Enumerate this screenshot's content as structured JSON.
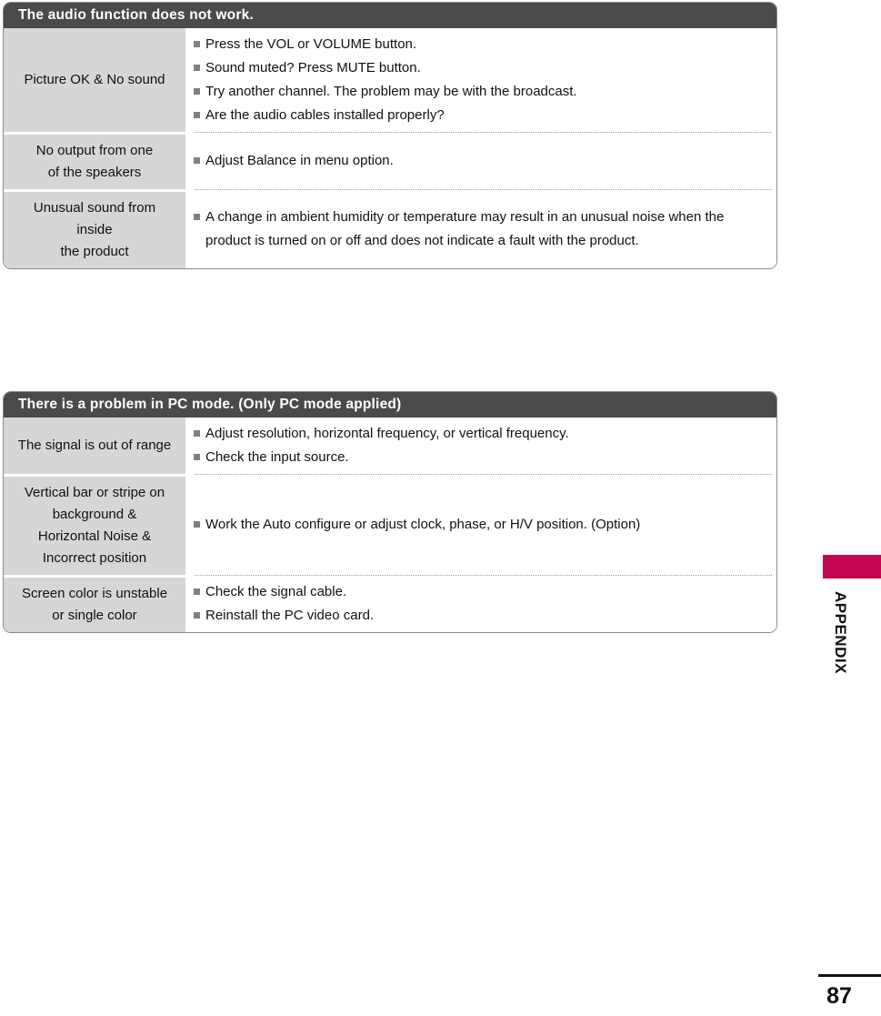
{
  "page": {
    "number": "87",
    "section_label": "APPENDIX",
    "tab_color": "#c4054e",
    "header_bar_color": "#4a4a4a",
    "symptom_cell_color": "#d6d6d6"
  },
  "tables": [
    {
      "title": "The audio function does not work.",
      "rows": [
        {
          "symptom_lines": [
            "Picture OK & No sound"
          ],
          "causes": [
            "Press the VOL or VOLUME button.",
            "Sound muted? Press MUTE button.",
            "Try another channel. The problem may be with the broadcast.",
            "Are the audio cables installed properly?"
          ]
        },
        {
          "symptom_lines": [
            "No output from one",
            "of the speakers"
          ],
          "causes": [
            "Adjust Balance in menu option."
          ]
        },
        {
          "symptom_lines": [
            "Unusual sound from",
            "inside",
            "the product"
          ],
          "causes": [
            "A change in ambient humidity or temperature may result in an unusual noise when the product is turned on or off and does not indicate a fault with the product."
          ]
        }
      ]
    },
    {
      "title": "There is a problem in PC mode. (Only PC mode applied)",
      "rows": [
        {
          "symptom_lines": [
            "The signal is out of range"
          ],
          "causes": [
            "Adjust resolution, horizontal frequency, or vertical frequency.",
            "Check the input source."
          ]
        },
        {
          "symptom_lines": [
            "Vertical bar or stripe on",
            "background &",
            "Horizontal Noise &",
            "Incorrect position"
          ],
          "causes": [
            "Work the Auto configure or adjust clock, phase, or H/V position. (Option)"
          ]
        },
        {
          "symptom_lines": [
            "Screen color is unstable",
            "or single color"
          ],
          "causes": [
            "Check the signal cable.",
            "Reinstall the PC video card."
          ]
        }
      ]
    }
  ]
}
